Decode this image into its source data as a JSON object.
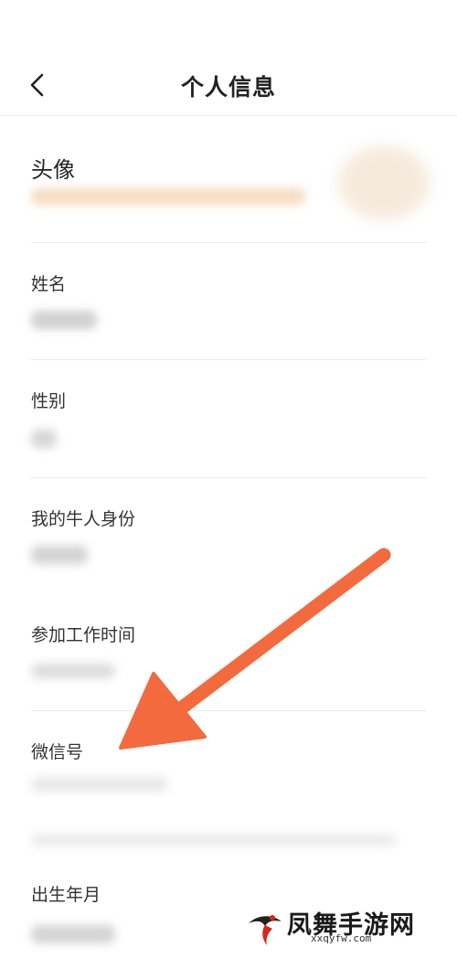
{
  "header": {
    "title": "个人信息",
    "back_icon": "chevron-left-icon"
  },
  "fields": [
    {
      "label": "头像"
    },
    {
      "label": "姓名"
    },
    {
      "label": "性别"
    },
    {
      "label": "我的牛人身份"
    },
    {
      "label": "参加工作时间"
    },
    {
      "label": "微信号"
    },
    {
      "label": "出生年月"
    }
  ],
  "annotation": {
    "arrow_color": "#f26a3e",
    "points_to": "微信号"
  },
  "watermark": {
    "name": "凤舞手游网",
    "url": "xxqyfw.com",
    "logo_icon": "phoenix-logo-icon"
  }
}
